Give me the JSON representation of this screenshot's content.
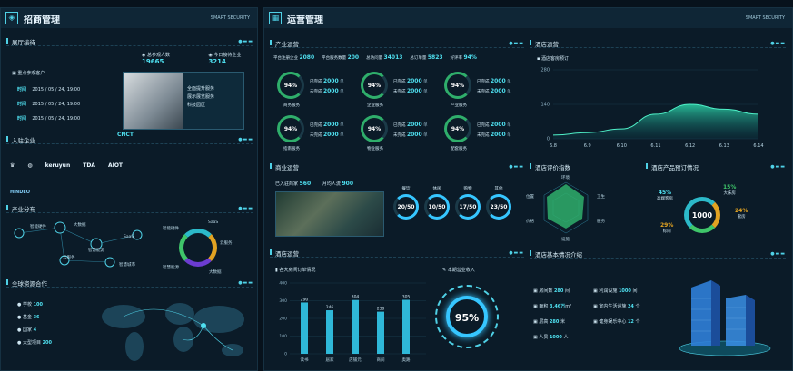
{
  "left": {
    "title": "招商管理",
    "tag": "SMART SECURITY",
    "exhibit": {
      "title": "展厅接待",
      "visit_label": "总参观人数",
      "visit_value": "19665",
      "today_label": "今日接待企业",
      "today_value": "3214",
      "recent_label": "重点参观客户",
      "rows": [
        {
          "k": "时间",
          "v": "2015 / 05 / 24, 19:00"
        },
        {
          "k": "时间",
          "v": "2015 / 05 / 24, 19:00"
        },
        {
          "k": "时间",
          "v": "2015 / 05 / 24, 19:00"
        }
      ],
      "photo_text": [
        "全面提升服务",
        "展示展览服务",
        "科技园区"
      ]
    },
    "companies": {
      "title": "入驻企业",
      "center": "CNCT",
      "logos": [
        "keruyun",
        "TDA",
        "AIOT",
        "HINDEO"
      ]
    },
    "industry": {
      "title": "产业分布",
      "nodes": [
        "智能硬件",
        "大数据",
        "SaaS",
        "云服务",
        "智慧能源",
        "智慧城市"
      ],
      "legend": [
        "智能硬件",
        "云服务",
        "SaaS",
        "大数据",
        "智慧能源"
      ]
    },
    "global": {
      "title": "全球资源合作",
      "items": [
        {
          "k": "学校",
          "v": "100"
        },
        {
          "k": "基金",
          "v": "36"
        },
        {
          "k": "国家",
          "v": "4"
        },
        {
          "k": "大型项目",
          "v": "200"
        }
      ]
    }
  },
  "right": {
    "title": "运营管理",
    "tag": "SMART SECURITY",
    "industry_ops": {
      "title": "产业运营",
      "stats": [
        {
          "k": "平台注册企业",
          "v": "2080"
        },
        {
          "k": "平台服务数量",
          "v": "200"
        },
        {
          "k": "总访问量",
          "v": "34013"
        },
        {
          "k": "总订单量",
          "v": "5823"
        },
        {
          "k": "好评率",
          "v": "94%"
        }
      ],
      "gauges": [
        {
          "pct": "94%",
          "name": "商务服务",
          "a": "2000",
          "b": "2000"
        },
        {
          "pct": "94%",
          "name": "企业服务",
          "a": "2000",
          "b": "2000"
        },
        {
          "pct": "94%",
          "name": "产业服务",
          "a": "2000",
          "b": "2000"
        },
        {
          "pct": "94%",
          "name": "指南服务",
          "a": "2000",
          "b": "2000"
        },
        {
          "pct": "94%",
          "name": "物业服务",
          "a": "2000",
          "b": "2000"
        },
        {
          "pct": "94%",
          "name": "配套服务",
          "a": "2000",
          "b": "2000"
        }
      ],
      "a_label": "已完成",
      "b_label": "未完成"
    },
    "commerce": {
      "title": "商业运营",
      "shops_label": "已入驻商家",
      "shops": "560",
      "area_label": "月均人流",
      "area": "900",
      "rings": [
        {
          "name": "餐饮",
          "v": "20/50"
        },
        {
          "name": "休闲",
          "v": "10/50"
        },
        {
          "name": "购物",
          "v": "17/50"
        },
        {
          "name": "其他",
          "v": "23/50"
        }
      ]
    },
    "hotel_ops": {
      "title": "酒店运营",
      "chart_title": "各大房间订单情况",
      "compare_title": "本期营业收入",
      "pct": "95%"
    },
    "hotel_monitor": {
      "title": "酒店运营",
      "sub": "酒店客房预订"
    },
    "rating": {
      "title": "酒店评价指数",
      "axes": [
        "环境",
        "卫生",
        "服务",
        "设施",
        "价格",
        "位置"
      ]
    },
    "booking": {
      "title": "酒店产品预订情况",
      "center": "1000",
      "items": [
        {
          "v": "45%",
          "k": "高端客房"
        },
        {
          "v": "15%",
          "k": "大床房"
        },
        {
          "v": "24%",
          "k": "套房"
        },
        {
          "v": "29%",
          "k": "标间"
        }
      ]
    },
    "basic": {
      "title": "酒店基本情况介绍",
      "items": [
        {
          "k": "房间数",
          "v": "280",
          "u": "间"
        },
        {
          "k": "利润设施",
          "v": "1000",
          "u": "间"
        },
        {
          "k": "面积",
          "v": "3.46万",
          "u": "m²"
        },
        {
          "k": "室内生活设施",
          "v": "24",
          "u": "个"
        },
        {
          "k": "层高",
          "v": "280",
          "u": "米"
        },
        {
          "k": "健身娱乐中心",
          "v": "12",
          "u": "个"
        },
        {
          "k": "人员",
          "v": "1000",
          "u": "人"
        }
      ]
    }
  },
  "chart_data": [
    {
      "type": "bar",
      "title": "各大房间订单情况",
      "categories": [
        "读书",
        "居家",
        "店铺元",
        "商间",
        "奥路"
      ],
      "values": [
        290,
        246,
        304,
        238,
        305
      ],
      "ylim": [
        0,
        400
      ]
    },
    {
      "type": "area",
      "title": "酒店客房预订",
      "x": [
        "6.8",
        "6.9",
        "6.10",
        "6.11",
        "6.12",
        "6.13",
        "6.14"
      ],
      "values": [
        15,
        25,
        40,
        100,
        140,
        120,
        100
      ],
      "ylim": [
        0,
        280
      ]
    }
  ]
}
